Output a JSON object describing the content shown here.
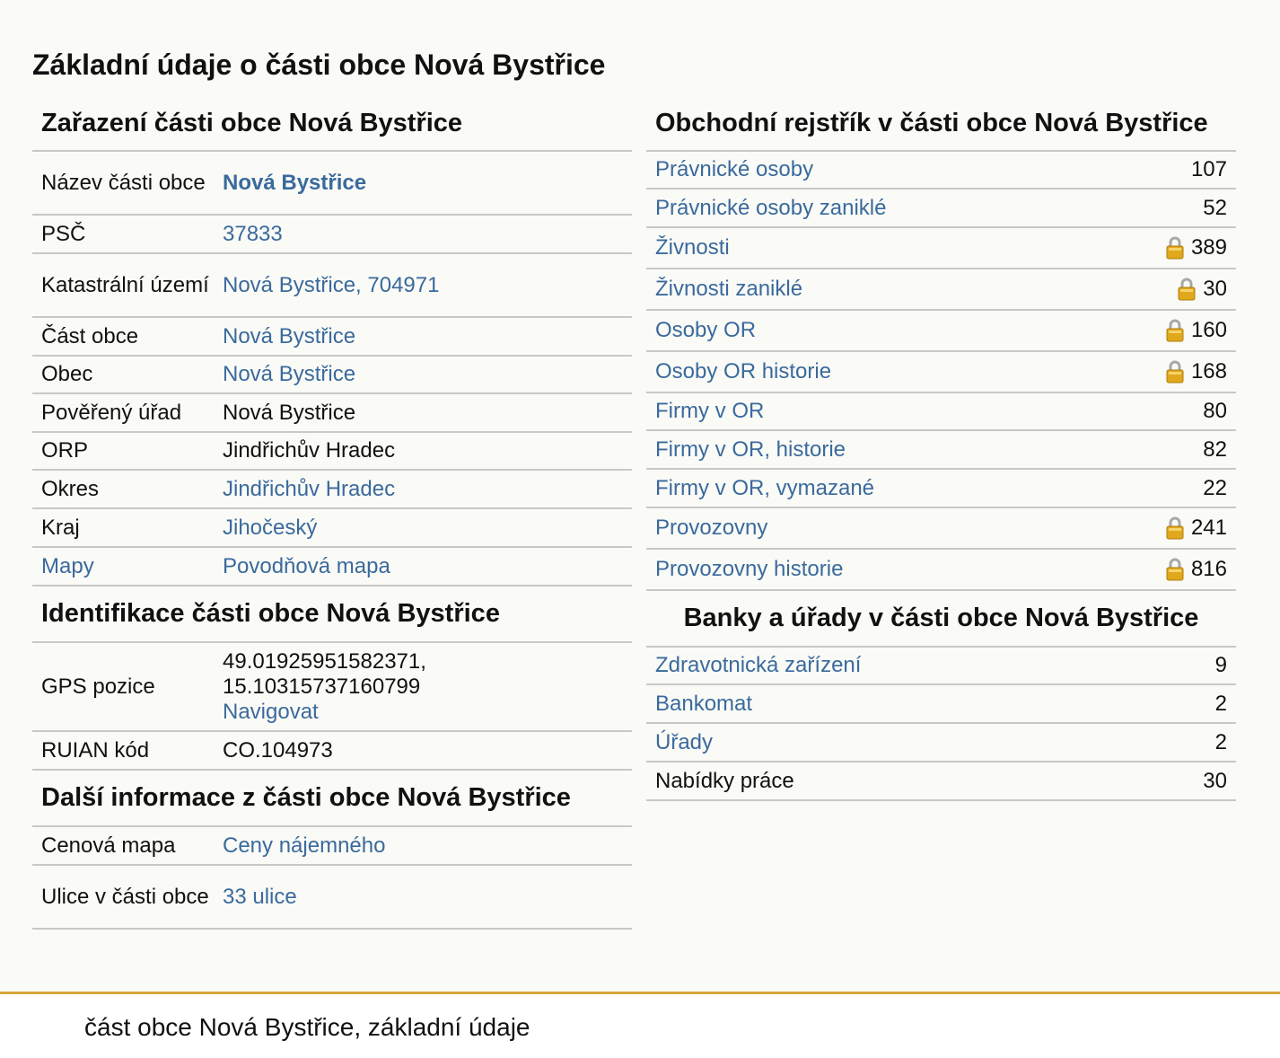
{
  "page": {
    "title": "Základní údaje o části obce Nová Bystřice"
  },
  "zarazeni": {
    "heading": "Zařazení části obce Nová Bystřice",
    "rows": [
      {
        "label": "Název části obce",
        "value": "Nová Bystřice"
      },
      {
        "label": "PSČ",
        "value": "37833"
      },
      {
        "label": "Katastrální území",
        "value": "Nová Bystřice, 704971"
      },
      {
        "label": "Část obce",
        "value": "Nová Bystřice"
      },
      {
        "label": "Obec",
        "value": "Nová Bystřice"
      },
      {
        "label": "Pověřený úřad",
        "value": "Nová Bystřice"
      },
      {
        "label": "ORP",
        "value": "Jindřichův Hradec"
      },
      {
        "label": "Okres",
        "value": "Jindřichův Hradec"
      },
      {
        "label": "Kraj",
        "value": "Jihočeský"
      },
      {
        "label": "Mapy",
        "value": "Povodňová mapa"
      }
    ]
  },
  "identifikace": {
    "heading": "Identifikace části obce Nová Bystřice",
    "gps_label": "GPS pozice",
    "gps_lat": "49.01925951582371,",
    "gps_lon": "15.10315737160799",
    "gps_nav": "Navigovat",
    "ruian_label": "RUIAN kód",
    "ruian_value": "CO.104973"
  },
  "dalsi": {
    "heading": "Další informace z části obce Nová Bystřice",
    "rows": [
      {
        "label": "Cenová mapa",
        "value": "Ceny nájemného"
      },
      {
        "label": "Ulice v části obce",
        "value": "33 ulice"
      }
    ]
  },
  "rejstrik": {
    "heading": "Obchodní rejstřík v části obce Nová Bystřice",
    "rows": [
      {
        "label": "Právnické osoby",
        "count": "107"
      },
      {
        "label": "Právnické osoby zaniklé",
        "count": "52"
      },
      {
        "label": "Živnosti",
        "count": "389"
      },
      {
        "label": "Živnosti zaniklé",
        "count": "30"
      },
      {
        "label": "Osoby OR",
        "count": "160"
      },
      {
        "label": "Osoby OR historie",
        "count": "168"
      },
      {
        "label": "Firmy v OR",
        "count": "80"
      },
      {
        "label": "Firmy v OR, historie",
        "count": "82"
      },
      {
        "label": "Firmy v OR, vymazané",
        "count": "22"
      },
      {
        "label": "Provozovny",
        "count": "241"
      },
      {
        "label": "Provozovny historie",
        "count": "816"
      }
    ]
  },
  "banky": {
    "heading": "Banky a úřady v části obce Nová Bystřice",
    "rows": [
      {
        "label": "Zdravotnická zařízení",
        "count": "9"
      },
      {
        "label": "Bankomat",
        "count": "2"
      },
      {
        "label": "Úřady",
        "count": "2"
      },
      {
        "label": "Nabídky práce",
        "count": "30"
      }
    ]
  },
  "icons": {
    "lock": "lock-icon"
  },
  "colors": {
    "link": "#3a6a9c",
    "accent_line": "#d9a43a",
    "lock": "#e0a81c"
  },
  "footer": {
    "text": "část obce Nová Bystřice, základní údaje"
  }
}
